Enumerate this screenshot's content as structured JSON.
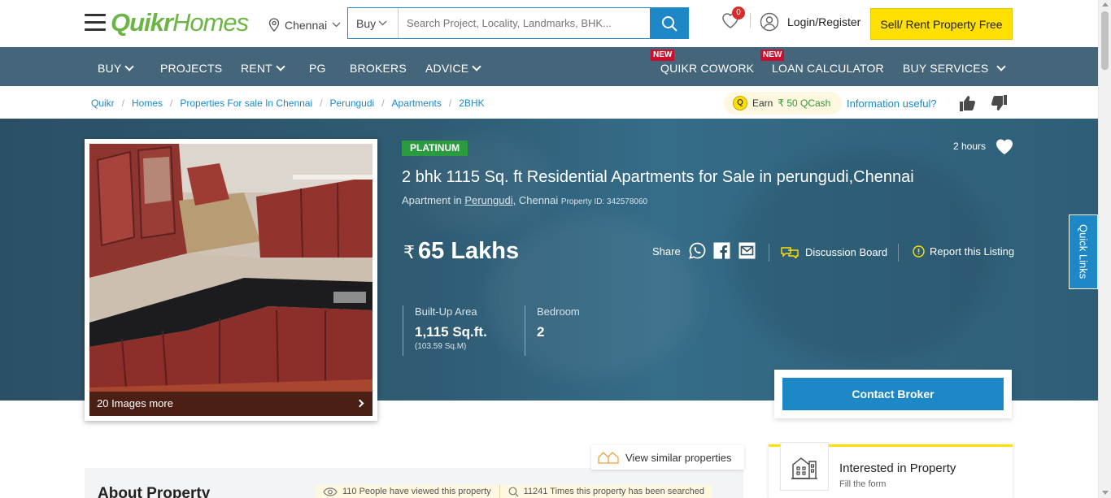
{
  "header": {
    "logo_quikr": "Quikr",
    "logo_homes": "Homes",
    "city": "Chennai",
    "search_mode": "Buy",
    "search_placeholder": "Search Project, Locality, Landmarks, BHK...",
    "wishlist_count": "0",
    "login_label": "Login/Register",
    "sell_label": "Sell/ Rent Property Free"
  },
  "nav": {
    "items": [
      {
        "label": "BUY"
      },
      {
        "label": "PROJECTS"
      },
      {
        "label": "RENT"
      },
      {
        "label": "PG"
      },
      {
        "label": "BROKERS"
      },
      {
        "label": "ADVICE"
      },
      {
        "label": "QUIKR COWORK",
        "tag": "NEW"
      },
      {
        "label": "LOAN CALCULATOR",
        "tag": "NEW"
      },
      {
        "label": "BUY SERVICES"
      }
    ]
  },
  "breadcrumb": [
    "Quikr",
    "Homes",
    "Properties For sale In Chennai",
    "Perungudi",
    "Apartments",
    "2BHK"
  ],
  "feedback": {
    "earn_prefix": "Earn",
    "earn_amount": "₹ 50 QCash",
    "coin": "Q",
    "question": "Information useful?"
  },
  "listing": {
    "tier": "PLATINUM",
    "posted": "2 hours",
    "title": "2 bhk 1115 Sq. ft Residential Apartments for Sale in perungudi,Chennai",
    "type_prefix": "Apartment in",
    "locality": "Perungudi,",
    "city": "Chennai",
    "property_id": "Property ID: 342578060",
    "price_symbol": "₹",
    "price": "65 Lakhs",
    "share_label": "Share",
    "discussion_label": "Discussion Board",
    "report_label": "Report this Listing",
    "images_more": "20 Images more",
    "specs": [
      {
        "label": "Built-Up Area",
        "value": "1,115 Sq.ft.",
        "sub": "(103.59 Sq.M)"
      },
      {
        "label": "Bedroom",
        "value": "2",
        "sub": ""
      }
    ],
    "contact_label": "Contact Broker",
    "quick_links": "Quick Links"
  },
  "below": {
    "similar_label": "View similar properties",
    "about_title": "About Property",
    "views_stat": "110 People have viewed this property",
    "search_stat": "11241 Times this property has been searched",
    "interested_title": "Interested in Property",
    "interested_sub": "Fill the form"
  },
  "colors": {
    "brand_green": "#6bb543",
    "brand_blue": "#1e88c7",
    "nav_bg": "#44657a",
    "sell_yellow": "#ffe000",
    "platinum_green": "#2a9b3f",
    "new_red": "#c8102e"
  }
}
